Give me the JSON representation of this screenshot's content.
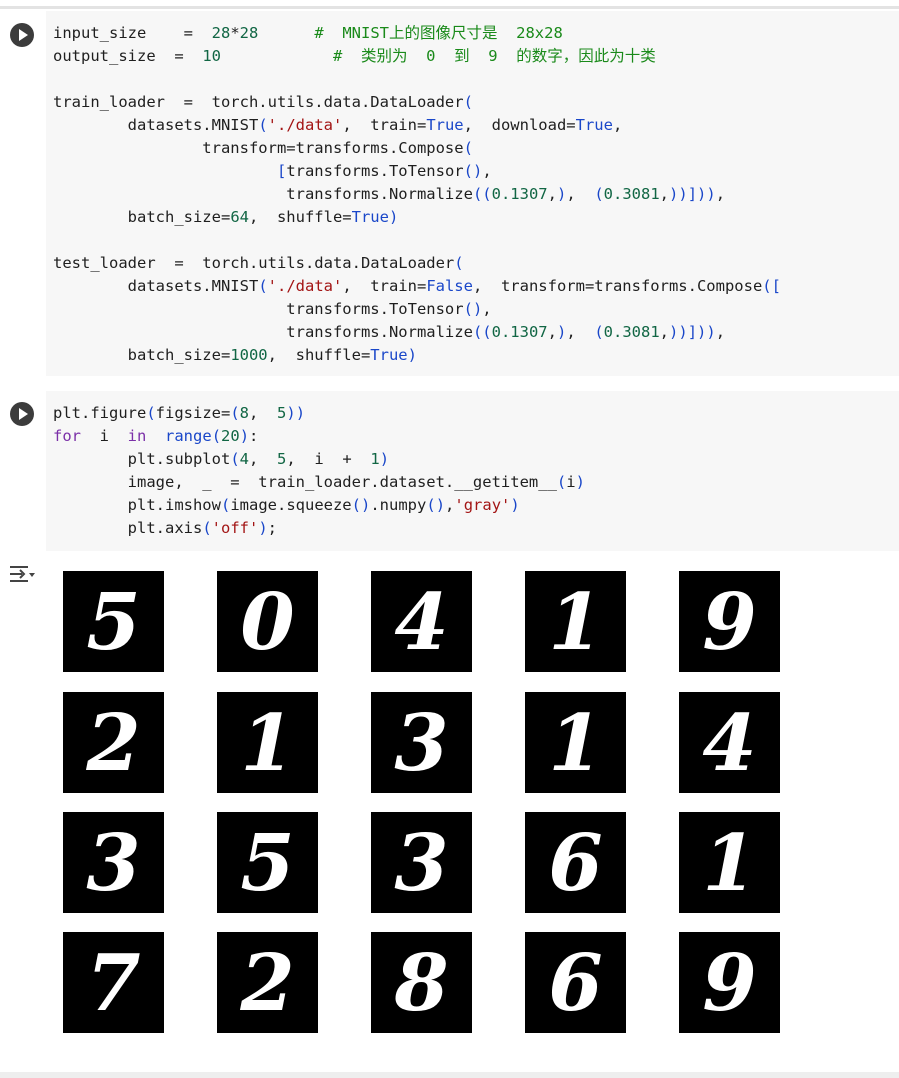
{
  "cell1": {
    "lines": [
      {
        "parts": [
          {
            "t": "input_size    =  28*28      #  MNIST上的图像尺寸是  28x28",
            "c": ""
          }
        ]
      },
      {
        "parts": [
          {
            "t": "output_size  =  10            #  类别为  0  到  9  的数字，因此为十类",
            "c": ""
          }
        ]
      },
      {
        "parts": [
          {
            "t": "",
            "c": ""
          }
        ]
      },
      {
        "parts": [
          {
            "t": "train_loader  =  torch.utils.data.DataLoader(",
            "c": ""
          }
        ]
      },
      {
        "parts": [
          {
            "t": "        datasets.MNIST('./data',  train=True,  download=True,",
            "c": ""
          }
        ]
      },
      {
        "parts": [
          {
            "t": "                transform=transforms.Compose(",
            "c": ""
          }
        ]
      },
      {
        "parts": [
          {
            "t": "                        [transforms.ToTensor(),",
            "c": ""
          }
        ]
      },
      {
        "parts": [
          {
            "t": "                         transforms.Normalize((0.1307,),  (0.3081,))])),",
            "c": ""
          }
        ]
      },
      {
        "parts": [
          {
            "t": "        batch_size=64,  shuffle=True)",
            "c": ""
          }
        ]
      },
      {
        "parts": [
          {
            "t": "",
            "c": ""
          }
        ]
      },
      {
        "parts": [
          {
            "t": "test_loader  =  torch.utils.data.DataLoader(",
            "c": ""
          }
        ]
      },
      {
        "parts": [
          {
            "t": "        datasets.MNIST('./data',  train=False,  transform=transforms.Compose([",
            "c": ""
          }
        ]
      },
      {
        "parts": [
          {
            "t": "                         transforms.ToTensor(),",
            "c": ""
          }
        ]
      },
      {
        "parts": [
          {
            "t": "                         transforms.Normalize((0.1307,),  (0.3081,))])),",
            "c": ""
          }
        ]
      },
      {
        "parts": [
          {
            "t": "        batch_size=1000,  shuffle=True)",
            "c": ""
          }
        ]
      }
    ]
  },
  "cell2": {
    "lines": [
      {
        "parts": [
          {
            "t": "plt.figure(figsize=(8,  5))",
            "c": ""
          }
        ]
      },
      {
        "parts": [
          {
            "t": "for  i  in  range(20):",
            "c": ""
          }
        ]
      },
      {
        "parts": [
          {
            "t": "        plt.subplot(4,  5,  i  +  1)",
            "c": ""
          }
        ]
      },
      {
        "parts": [
          {
            "t": "        image,  _  =  train_loader.dataset.__getitem__(i)",
            "c": ""
          }
        ]
      },
      {
        "parts": [
          {
            "t": "        plt.imshow(image.squeeze().numpy(),'gray')",
            "c": ""
          }
        ]
      },
      {
        "parts": [
          {
            "t": "        plt.axis('off');",
            "c": ""
          }
        ]
      }
    ]
  },
  "output": {
    "icon": "output-toggle-icon",
    "digits": [
      "5",
      "0",
      "4",
      "1",
      "9",
      "2",
      "1",
      "3",
      "1",
      "4",
      "3",
      "5",
      "3",
      "6",
      "1",
      "7",
      "2",
      "8",
      "6",
      "9"
    ]
  },
  "colors": {
    "keyword": "#7b30a8",
    "number": "#116644",
    "string": "#a31515",
    "comment": "#1a8a1a",
    "builtin_const": "#1a47c9"
  }
}
